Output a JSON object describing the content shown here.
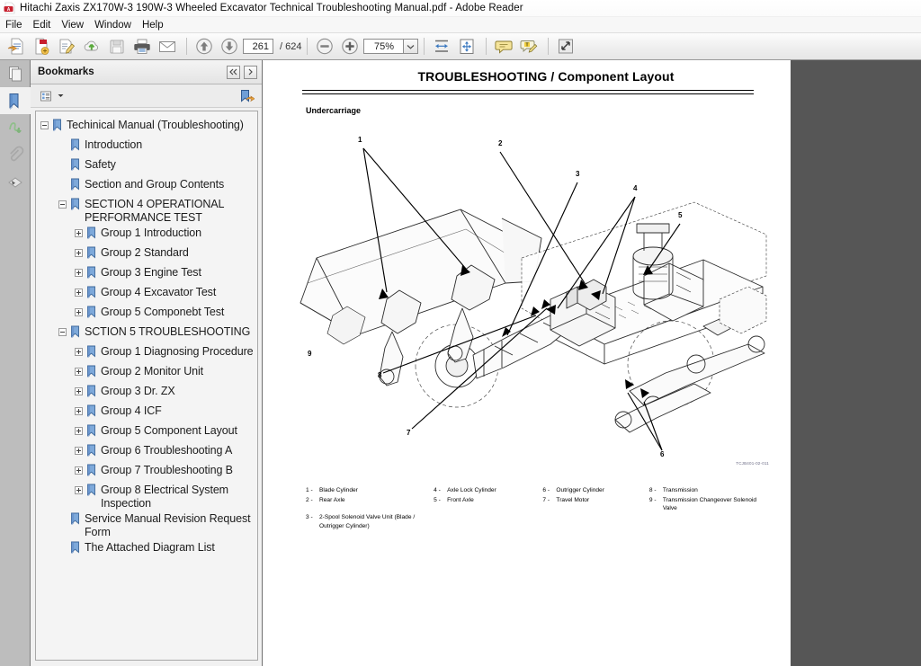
{
  "window": {
    "title": "Hitachi Zaxis ZX170W-3 190W-3 Wheeled Excavator Technical Troubleshooting Manual.pdf - Adobe Reader",
    "app_icon": "adobe-pdf-icon"
  },
  "menu": [
    {
      "label": "File"
    },
    {
      "label": "Edit"
    },
    {
      "label": "View"
    },
    {
      "label": "Window"
    },
    {
      "label": "Help"
    }
  ],
  "toolbar": {
    "buttons": [
      {
        "name": "open-file-icon"
      },
      {
        "name": "create-pdf-icon"
      },
      {
        "name": "edit-pdf-icon"
      },
      {
        "name": "upload-cloud-icon"
      },
      {
        "name": "save-icon"
      },
      {
        "name": "print-icon"
      },
      {
        "name": "email-icon"
      }
    ],
    "prev_page": "previous-page-icon",
    "next_page": "next-page-icon",
    "page_current": "261",
    "page_total": "/ 624",
    "zoom_out": "zoom-out-icon",
    "zoom_in": "zoom-in-icon",
    "zoom_value": "75%",
    "zoom_dropdown": "chevron-down-icon",
    "fit_width": "fit-width-icon",
    "fit_page": "fit-page-icon",
    "comment": "sticky-note-icon",
    "highlight": "highlight-text-icon",
    "fullscreen": "fullscreen-icon"
  },
  "rail": [
    {
      "name": "page-thumbnails-icon",
      "active": false
    },
    {
      "name": "bookmarks-icon",
      "active": true
    },
    {
      "name": "signatures-icon",
      "active": false
    },
    {
      "name": "attachments-icon",
      "active": false
    },
    {
      "name": "layers-icon",
      "active": false
    }
  ],
  "panel": {
    "title": "Bookmarks",
    "collapse_all": "collapse-all-icon",
    "expand_next": "expand-next-icon",
    "options_menu": "bookmark-options-icon",
    "options_caret": "caret-down-icon",
    "new_bookmark": "new-bookmark-icon",
    "items": [
      {
        "label": "Techinical Manual (Troubleshooting)",
        "level": 0,
        "toggle": "minus"
      },
      {
        "label": "Introduction",
        "level": 1,
        "toggle": "none"
      },
      {
        "label": "Safety",
        "level": 1,
        "toggle": "none"
      },
      {
        "label": "Section and Group Contents",
        "level": 1,
        "toggle": "none"
      },
      {
        "label": "SECTION 4 OPERATIONAL PERFORMANCE TEST",
        "level": 1,
        "toggle": "minus"
      },
      {
        "label": "Group 1 Introduction",
        "level": 2,
        "toggle": "plus"
      },
      {
        "label": "Group 2 Standard",
        "level": 2,
        "toggle": "plus"
      },
      {
        "label": "Group 3 Engine Test",
        "level": 2,
        "toggle": "plus"
      },
      {
        "label": "Group 4 Excavator Test",
        "level": 2,
        "toggle": "plus"
      },
      {
        "label": "Group 5 Componebt Test",
        "level": 2,
        "toggle": "plus"
      },
      {
        "label": "SCTION 5 TROUBLESHOOTING",
        "level": 1,
        "toggle": "minus"
      },
      {
        "label": "Group 1 Diagnosing Procedure",
        "level": 2,
        "toggle": "plus"
      },
      {
        "label": "Group 2 Monitor Unit",
        "level": 2,
        "toggle": "plus"
      },
      {
        "label": "Group 3 Dr. ZX",
        "level": 2,
        "toggle": "plus"
      },
      {
        "label": "Group 4 ICF",
        "level": 2,
        "toggle": "plus"
      },
      {
        "label": "Group 5 Component Layout",
        "level": 2,
        "toggle": "plus"
      },
      {
        "label": "Group 6 Troubleshooting A",
        "level": 2,
        "toggle": "plus"
      },
      {
        "label": "Group 7 Troubleshooting B",
        "level": 2,
        "toggle": "plus"
      },
      {
        "label": "Group 8 Electrical System Inspection",
        "level": 2,
        "toggle": "plus"
      },
      {
        "label": "Service Manual Revision Request Form",
        "level": 1,
        "toggle": "none"
      },
      {
        "label": "The Attached Diagram List",
        "level": 1,
        "toggle": "none"
      }
    ]
  },
  "document": {
    "title": "TROUBLESHOOTING / Component Layout",
    "section_label": "Undercarriage",
    "figure_code": "TCJB401-02-011",
    "callouts": [
      "1",
      "2",
      "3",
      "4",
      "5",
      "6",
      "7",
      "8",
      "9"
    ],
    "legend": {
      "col1": [
        {
          "num": "1 -",
          "text": "Blade Cylinder"
        },
        {
          "num": "2 -",
          "text": "Rear Axle"
        },
        {
          "num": "3 -",
          "text": "2-Spool Solenoid Valve Unit (Blade / Outrigger Cylinder)"
        }
      ],
      "col2": [
        {
          "num": "4 -",
          "text": "Axle Lock Cylinder"
        },
        {
          "num": "5 -",
          "text": "Front Axle"
        }
      ],
      "col3": [
        {
          "num": "6 -",
          "text": "Outrigger Cylinder"
        },
        {
          "num": "7 -",
          "text": "Travel Motor"
        }
      ],
      "col4": [
        {
          "num": "8 -",
          "text": "Transmission"
        },
        {
          "num": "9 -",
          "text": "Transmission Changeover Solenoid Valve"
        }
      ]
    }
  }
}
